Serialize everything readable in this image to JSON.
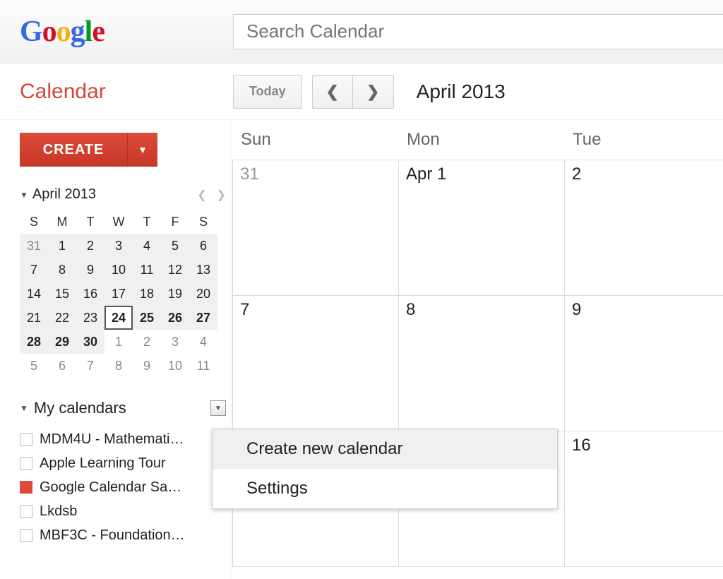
{
  "search": {
    "placeholder": "Search Calendar"
  },
  "app_title": "Calendar",
  "toolbar": {
    "today_label": "Today",
    "display_date": "April 2013"
  },
  "create_label": "CREATE",
  "mini": {
    "title": "April 2013",
    "dow": [
      "S",
      "M",
      "T",
      "W",
      "T",
      "F",
      "S"
    ],
    "days": [
      {
        "d": "31",
        "in": true,
        "out": true
      },
      {
        "d": "1",
        "in": true
      },
      {
        "d": "2",
        "in": true
      },
      {
        "d": "3",
        "in": true
      },
      {
        "d": "4",
        "in": true
      },
      {
        "d": "5",
        "in": true
      },
      {
        "d": "6",
        "in": true
      },
      {
        "d": "7",
        "in": true
      },
      {
        "d": "8",
        "in": true
      },
      {
        "d": "9",
        "in": true
      },
      {
        "d": "10",
        "in": true
      },
      {
        "d": "11",
        "in": true
      },
      {
        "d": "12",
        "in": true
      },
      {
        "d": "13",
        "in": true
      },
      {
        "d": "14",
        "in": true
      },
      {
        "d": "15",
        "in": true
      },
      {
        "d": "16",
        "in": true
      },
      {
        "d": "17",
        "in": true
      },
      {
        "d": "18",
        "in": true
      },
      {
        "d": "19",
        "in": true
      },
      {
        "d": "20",
        "in": true
      },
      {
        "d": "21",
        "in": true
      },
      {
        "d": "22",
        "in": true
      },
      {
        "d": "23",
        "in": true
      },
      {
        "d": "24",
        "in": true,
        "today": true
      },
      {
        "d": "25",
        "in": true,
        "bold": true
      },
      {
        "d": "26",
        "in": true,
        "bold": true
      },
      {
        "d": "27",
        "in": true,
        "bold": true
      },
      {
        "d": "28",
        "in": true,
        "bold": true
      },
      {
        "d": "29",
        "in": true,
        "bold": true
      },
      {
        "d": "30",
        "in": true,
        "bold": true
      },
      {
        "d": "1",
        "out": true
      },
      {
        "d": "2",
        "out": true
      },
      {
        "d": "3",
        "out": true
      },
      {
        "d": "4",
        "out": true
      },
      {
        "d": "5",
        "out": true
      },
      {
        "d": "6",
        "out": true
      },
      {
        "d": "7",
        "out": true
      },
      {
        "d": "8",
        "out": true
      },
      {
        "d": "9",
        "out": true
      },
      {
        "d": "10",
        "out": true
      },
      {
        "d": "11",
        "out": true
      }
    ]
  },
  "my_calendars": {
    "title": "My calendars",
    "items": [
      {
        "label": "MDM4U - Mathemati…",
        "color": ""
      },
      {
        "label": "Apple Learning Tour",
        "color": ""
      },
      {
        "label": "Google Calendar Sa…",
        "color": "red"
      },
      {
        "label": "Lkdsb",
        "color": ""
      },
      {
        "label": "MBF3C - Foundation…",
        "color": ""
      }
    ]
  },
  "grid": {
    "dow": [
      "Sun",
      "Mon",
      "Tue"
    ],
    "rows": [
      [
        "31",
        "Apr 1",
        "2"
      ],
      [
        "7",
        "8",
        "9"
      ],
      [
        "",
        "",
        "16"
      ]
    ],
    "dim": {
      "0": {
        "0": true
      }
    }
  },
  "menu": {
    "items": [
      {
        "label": "Create new calendar",
        "hover": true
      },
      {
        "label": "Settings",
        "hover": false
      }
    ]
  }
}
